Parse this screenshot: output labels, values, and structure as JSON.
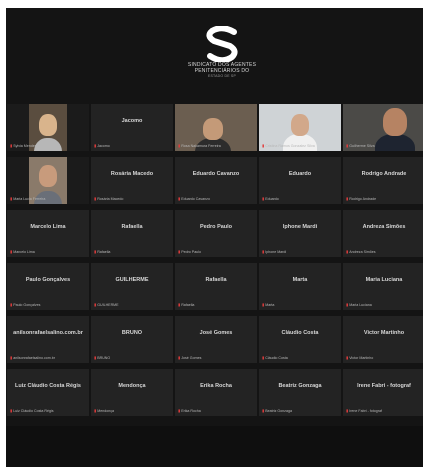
{
  "logo": {
    "line1": "SINDICATO DOS AGENTES",
    "line2": "PENITENCIÁRIOS DO",
    "line3": "ESTADO DE SP"
  },
  "participants": [
    {
      "name": "",
      "tag": "Sylvia Mendes",
      "video": true
    },
    {
      "name": "Jacomo",
      "tag": "Jacomo",
      "video": false
    },
    {
      "name": "",
      "tag": "Rosa Nakamura Ferreira",
      "video": true
    },
    {
      "name": "",
      "tag": "Cristina Ramos Gonzalez Silva",
      "video": true
    },
    {
      "name": "",
      "tag": "Guilherme Silva",
      "video": true
    },
    {
      "name": "",
      "tag": "Maria Lucia Ferreira",
      "video": true
    },
    {
      "name": "Rosária Macedo",
      "tag": "Rosária Macedo",
      "video": false
    },
    {
      "name": "Eduardo Cavanzo",
      "tag": "Eduardo Cavanzo",
      "video": false
    },
    {
      "name": "Eduardo",
      "tag": "Eduardo",
      "video": false
    },
    {
      "name": "Rodrigo Andrade",
      "tag": "Rodrigo Andrade",
      "video": false
    },
    {
      "name": "Marcelo Lima",
      "tag": "Marcelo Lima",
      "video": false
    },
    {
      "name": "Rafaella",
      "tag": "Rafaella",
      "video": false
    },
    {
      "name": "Pedro Paulo",
      "tag": "Pedro Paulo",
      "video": false
    },
    {
      "name": "Iphone Mardi",
      "tag": "Iphone Mardi",
      "video": false
    },
    {
      "name": "Andreza Simões",
      "tag": "Andreza Simões",
      "video": false
    },
    {
      "name": "Paulo Gonçalves",
      "tag": "Paulo Gonçalves",
      "video": false
    },
    {
      "name": "GUILHERME",
      "tag": "GUILHERME",
      "video": false
    },
    {
      "name": "Rafaella",
      "tag": "Rafaella",
      "video": false
    },
    {
      "name": "Marta",
      "tag": "Marta",
      "video": false
    },
    {
      "name": "Maria Luciana",
      "tag": "Maria Luciana",
      "video": false
    },
    {
      "name": "anilsonrafaelsalino.com.br",
      "tag": "anilsonrafaelsalino.com.br",
      "video": false
    },
    {
      "name": "BRUNO",
      "tag": "BRUNO",
      "video": false
    },
    {
      "name": "José Gomes",
      "tag": "José Gomes",
      "video": false
    },
    {
      "name": "Cláudio Costa",
      "tag": "Cláudio Costa",
      "video": false
    },
    {
      "name": "Victor Martinho",
      "tag": "Victor Martinho",
      "video": false
    },
    {
      "name": "Luiz Cláudio Costa Régis",
      "tag": "Luiz Cláudio Costa Régis",
      "video": false
    },
    {
      "name": "Mendonça",
      "tag": "Mendonça",
      "video": false
    },
    {
      "name": "Erika Rocha",
      "tag": "Erika Rocha",
      "video": false
    },
    {
      "name": "Beatriz Gonzaga",
      "tag": "Beatriz Gonzaga",
      "video": false
    },
    {
      "name": "Irene Fabri - fotograf",
      "tag": "Irene Fabri - fotograf",
      "video": false
    }
  ]
}
